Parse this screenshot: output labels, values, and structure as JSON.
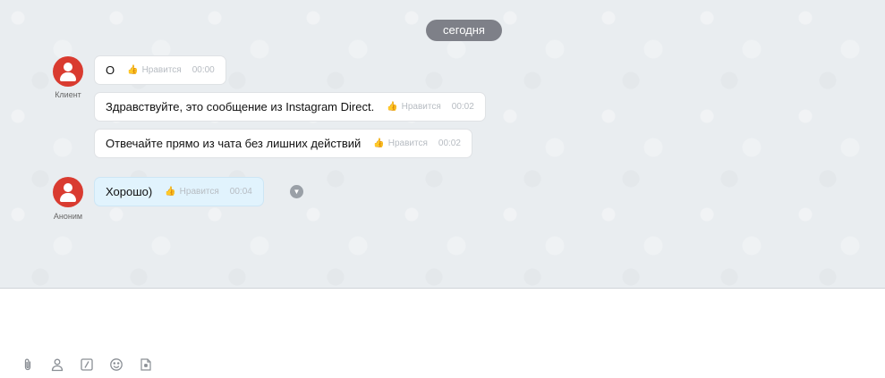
{
  "chat": {
    "date_label": "сегодня",
    "groups": [
      {
        "author": "Клиент",
        "messages": [
          {
            "text": "О",
            "like_label": "Нравится",
            "time": "00:00"
          },
          {
            "text": "Здравствуйте, это сообщение из Instagram Direct.",
            "like_label": "Нравится",
            "time": "00:02"
          },
          {
            "text": "Отвечайте прямо из чата без лишних действий",
            "like_label": "Нравится",
            "time": "00:02"
          }
        ]
      },
      {
        "author": "Аноним",
        "messages": [
          {
            "text": "Хорошо)",
            "like_label": "Нравится",
            "time": "00:04"
          }
        ]
      }
    ]
  },
  "composer": {
    "placeholder": "",
    "tools": [
      "paperclip-icon",
      "person-icon",
      "slash-command-icon",
      "emoji-icon",
      "sticker-icon"
    ]
  },
  "colors": {
    "avatar": "#d93b30",
    "date_pill": "#7e8088",
    "anon_bubble": "#e1f3fd",
    "chat_background": "#e9edf0"
  }
}
